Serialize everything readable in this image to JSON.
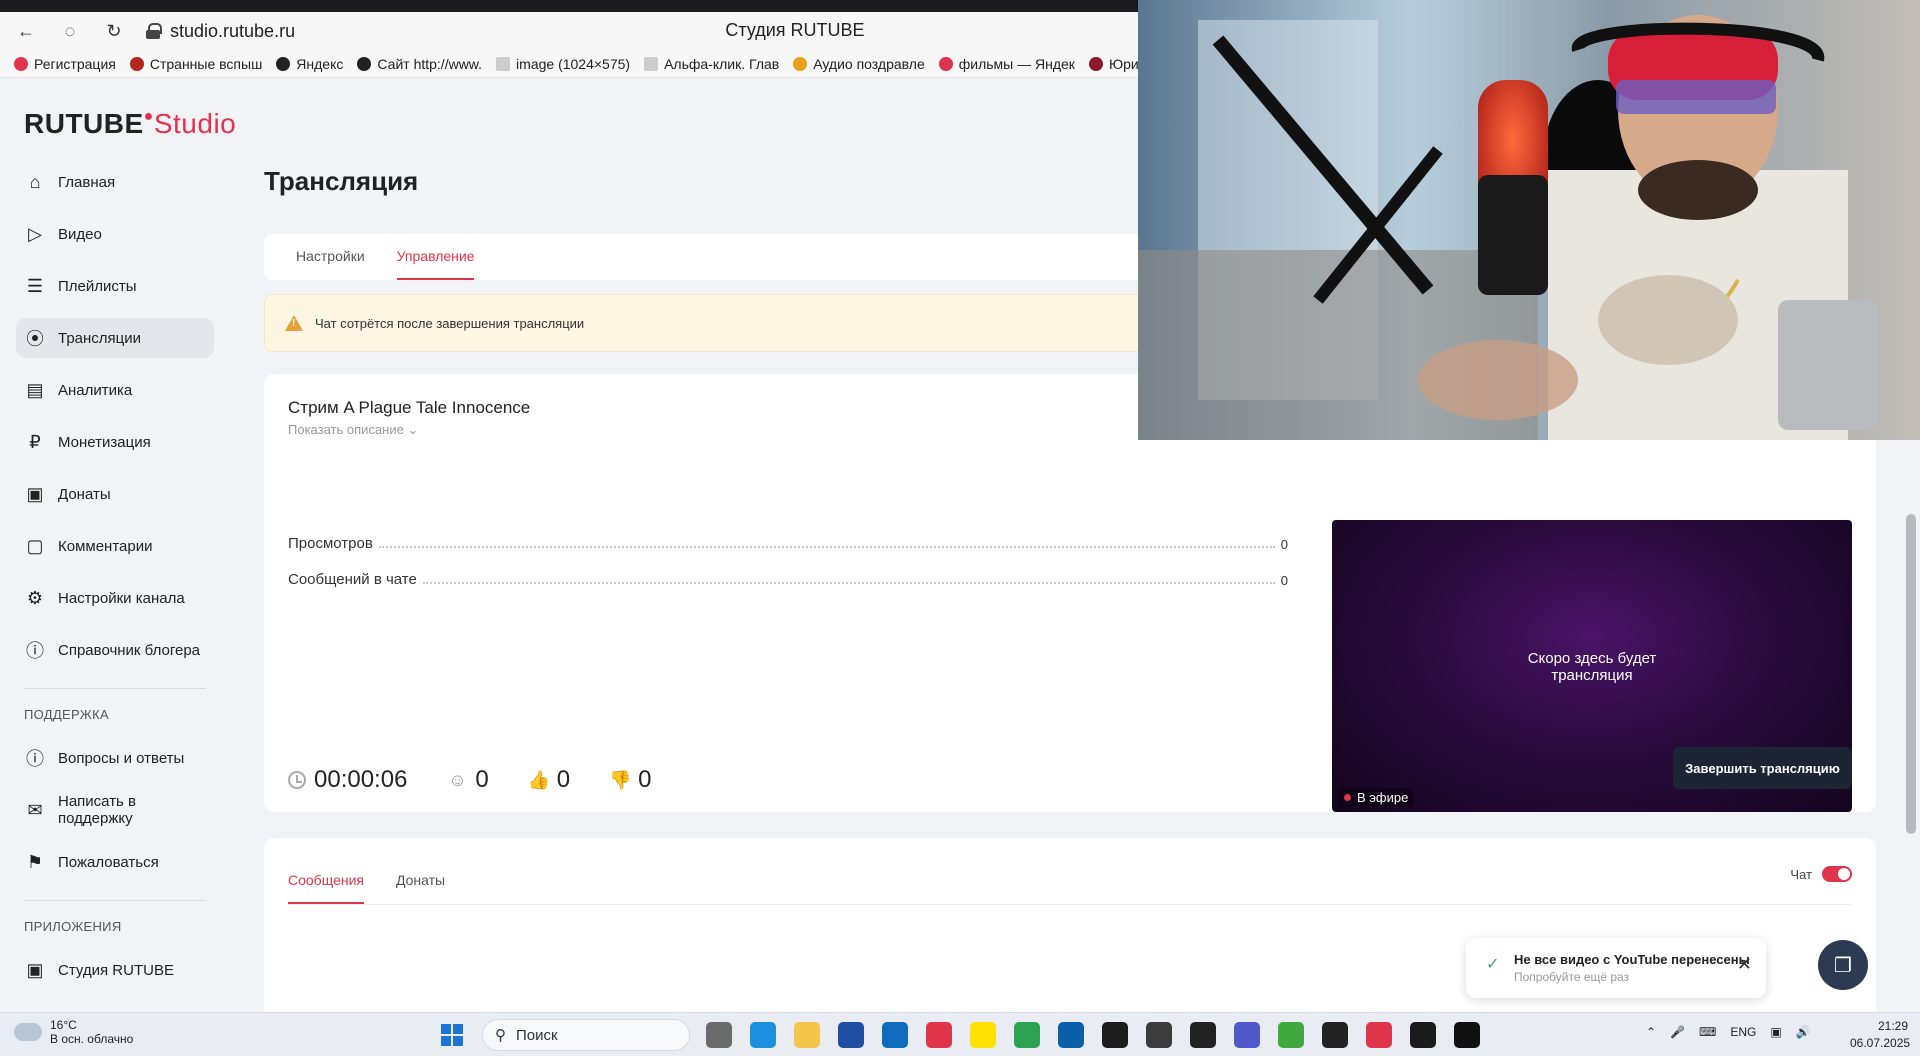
{
  "browser": {
    "url": "studio.rutube.ru",
    "title": "Студия RUTUBE",
    "bookmarks": [
      {
        "label": "Регистрация",
        "color": "#e0344a"
      },
      {
        "label": "Странные вспыш",
        "color": "#b5271b"
      },
      {
        "label": "Яндекс",
        "color": "#222222"
      },
      {
        "label": "Сайт http://www.",
        "color": "#222222"
      },
      {
        "label": "image (1024×575)",
        "color": "#666666"
      },
      {
        "label": "Альфа-клик. Глав",
        "color": "#666666"
      },
      {
        "label": "Аудио поздравле",
        "color": "#e6a21a"
      },
      {
        "label": "фильмы — Яндек",
        "color": "#e0344a"
      },
      {
        "label": "Юридически",
        "color": "#8a1c2b"
      }
    ]
  },
  "logo": {
    "brand": "RUTUBE",
    "studio": "Studio"
  },
  "sidebar": {
    "items": [
      {
        "label": "Главная",
        "icon": "home-icon"
      },
      {
        "label": "Видео",
        "icon": "video-icon"
      },
      {
        "label": "Плейлисты",
        "icon": "playlist-icon"
      },
      {
        "label": "Трансляции",
        "icon": "broadcast-icon"
      },
      {
        "label": "Аналитика",
        "icon": "analytics-icon"
      },
      {
        "label": "Монетизация",
        "icon": "ruble-icon"
      },
      {
        "label": "Донаты",
        "icon": "wallet-icon"
      },
      {
        "label": "Комментарии",
        "icon": "comment-icon"
      },
      {
        "label": "Настройки канала",
        "icon": "gear-icon"
      },
      {
        "label": "Справочник блогера",
        "icon": "info-icon"
      }
    ],
    "support_heading": "ПОДДЕРЖКА",
    "support_items": [
      {
        "label": "Вопросы и ответы",
        "icon": "question-icon"
      },
      {
        "label": "Написать в поддержку",
        "icon": "mail-icon"
      },
      {
        "label": "Пожаловаться",
        "icon": "flag-icon"
      }
    ],
    "apps_heading": "ПРИЛОЖЕНИЯ",
    "apps_items": [
      {
        "label": "Студия RUTUBE",
        "icon": "studio-icon"
      }
    ]
  },
  "main": {
    "title": "Трансляция",
    "tabs": [
      "Настройки",
      "Управление"
    ],
    "warning": "Чат сотрётся после завершения трансляции",
    "stream": {
      "title": "Стрим A Plague Tale Innocence",
      "show_description": "Показать описание",
      "stats": [
        {
          "label": "Просмотров",
          "value": "0"
        },
        {
          "label": "Сообщений в чате",
          "value": "0"
        }
      ],
      "preview_text_1": "Скоро здесь будет",
      "preview_text_2": "трансляция",
      "live_label": "В эфире",
      "duration": "00:00:06",
      "viewers": "0",
      "likes": "0",
      "dislikes": "0",
      "end_button": "Завершить трансляцию"
    },
    "chat": {
      "tabs": [
        "Сообщения",
        "Донаты"
      ],
      "toggle_label": "Чат"
    }
  },
  "toast": {
    "title": "Не все видео с YouTube перенесены",
    "subtitle": "Попробуйте ещё раз"
  },
  "taskbar": {
    "temp": "16°C",
    "weather": "В осн. облачно",
    "search_placeholder": "Поиск",
    "lang": "ENG",
    "time": "21:29",
    "date": "06.07.2025"
  }
}
